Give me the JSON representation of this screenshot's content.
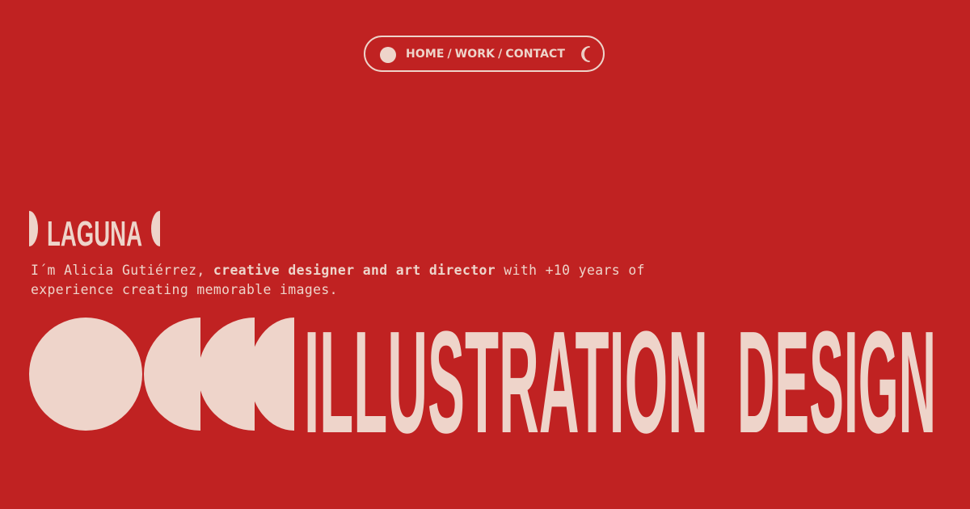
{
  "nav": {
    "home": "HOME",
    "work": "WORK",
    "contact": "CONTACT",
    "separator": "/"
  },
  "logo": {
    "text": "LAGUNA"
  },
  "intro": {
    "part1": "I´m Alicia Gutiérrez, ",
    "bold": "creative designer and art director",
    "part2": " with +10 years of experience creating memorable images."
  },
  "headline": {
    "word1": "ILLUSTRATION",
    "word2": "DESIGN"
  },
  "colors": {
    "background": "#c02222",
    "foreground": "#eed4ca"
  },
  "icons": {
    "nav_dot": "circle-icon",
    "theme_toggle": "moon-icon"
  }
}
